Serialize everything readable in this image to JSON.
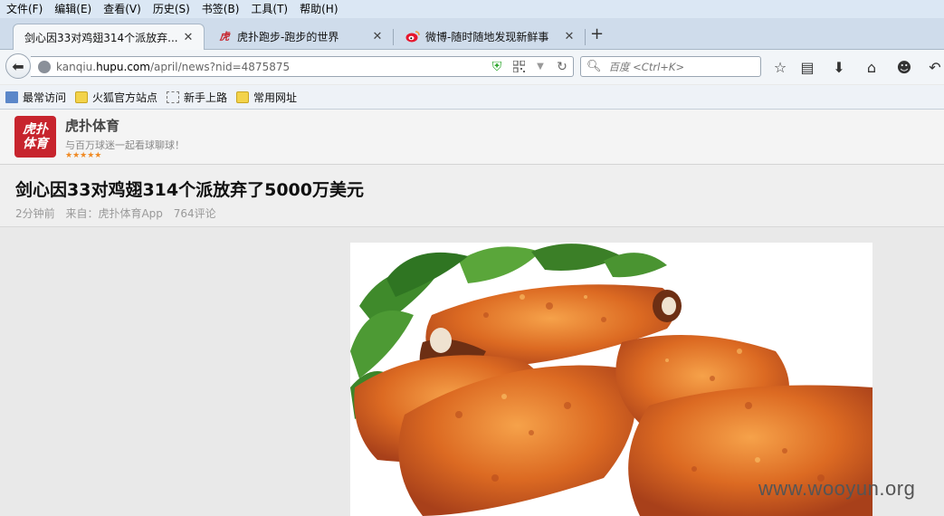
{
  "menu": [
    "文件(F)",
    "编辑(E)",
    "查看(V)",
    "历史(S)",
    "书签(B)",
    "工具(T)",
    "帮助(H)"
  ],
  "tabs": [
    {
      "title": "剑心因33对鸡翅314个派放弃...",
      "favicon": "hupu-icon"
    },
    {
      "title": "虎扑跑步-跑步的世界",
      "favicon": "hupu-icon"
    },
    {
      "title": "微博-随时随地发现新鲜事",
      "favicon": "weibo-icon"
    }
  ],
  "url": {
    "prefix": "kanqiu.",
    "host": "hupu.com",
    "path": "/april/news?nid=4875875"
  },
  "search": {
    "placeholder": "百度 <Ctrl+K>"
  },
  "bookmarks": [
    "最常访问",
    "火狐官方站点",
    "新手上路",
    "常用网址"
  ],
  "site": {
    "name": "虎扑体育",
    "slogan": "与百万球迷一起看球聊球！",
    "logo_line1": "虎扑",
    "logo_line2": "体育",
    "stars": "★★★★★"
  },
  "article": {
    "title": "剑心因33对鸡翅314个派放弃了5000万美元",
    "time": "2分钟前",
    "source": "来自：虎扑体育App",
    "comments": "764评论"
  },
  "watermark": "www.wooyun.org",
  "colors": {
    "brand_red": "#c7242d",
    "star_orange": "#f08a24",
    "menu_bg": "#dbe7f4"
  }
}
